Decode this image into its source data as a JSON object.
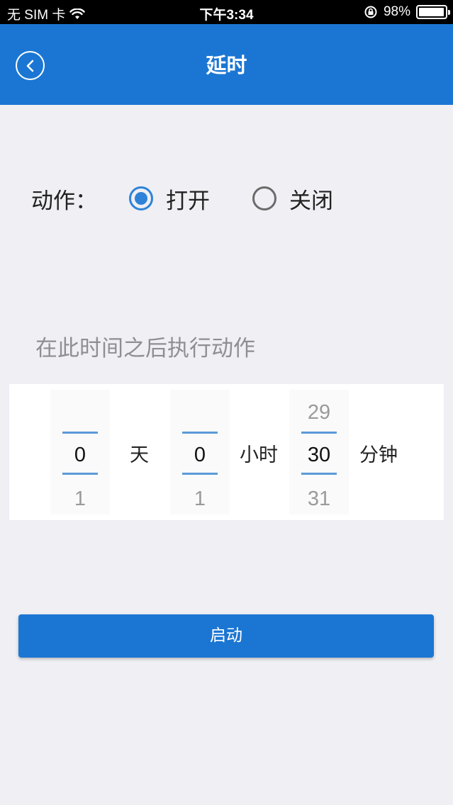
{
  "status_bar": {
    "carrier": "无 SIM 卡",
    "time": "下午3:34",
    "battery": "98%",
    "battery_level": 0.98
  },
  "nav": {
    "title": "延时",
    "back_icon": "chevron-left-circle-icon"
  },
  "action": {
    "label": "动作：",
    "options": [
      {
        "label": "打开",
        "selected": true
      },
      {
        "label": "关闭",
        "selected": false
      }
    ]
  },
  "hint": "在此时间之后执行动作",
  "picker": {
    "days": {
      "prev": "",
      "current": "0",
      "next": "1",
      "unit": "天"
    },
    "hours": {
      "prev": "",
      "current": "0",
      "next": "1",
      "unit": "小时"
    },
    "minutes": {
      "prev": "29",
      "current": "30",
      "next": "31",
      "unit": "分钟"
    }
  },
  "start_button": "启动",
  "colors": {
    "accent": "#1b76d3",
    "background": "#efeff4",
    "radio_selected": "#2e83d8"
  }
}
